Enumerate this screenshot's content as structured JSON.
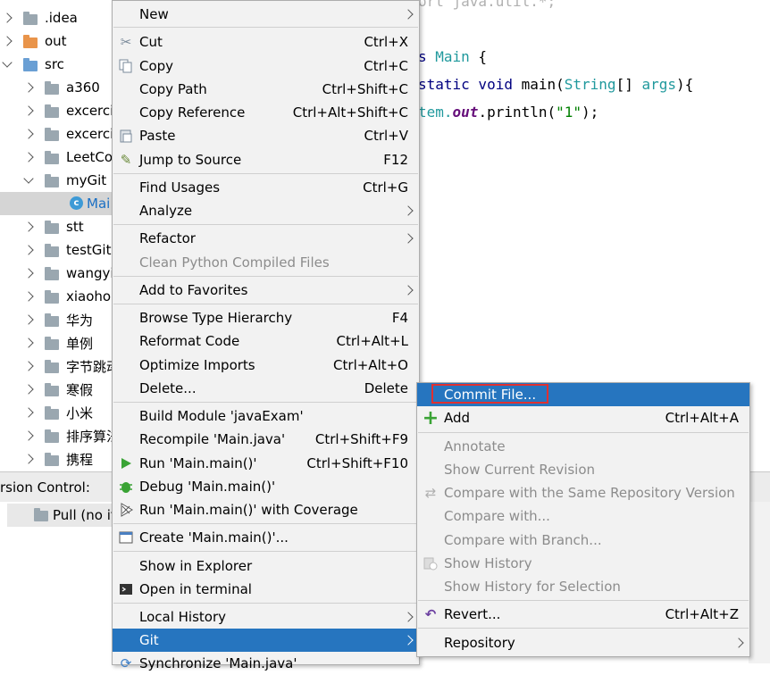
{
  "tree": {
    "items": [
      {
        "label": ".idea",
        "arrow": "right",
        "folder": "gray"
      },
      {
        "label": "out",
        "arrow": "right",
        "folder": "orange"
      },
      {
        "label": "src",
        "arrow": "down",
        "folder": "blue"
      },
      {
        "label": "a360",
        "arrow": "right",
        "folder": "gray"
      },
      {
        "label": "excerci",
        "arrow": "right",
        "folder": "gray"
      },
      {
        "label": "excerci",
        "arrow": "right",
        "folder": "gray"
      },
      {
        "label": "LeetCo",
        "arrow": "right",
        "folder": "gray"
      },
      {
        "label": "myGit",
        "arrow": "down",
        "folder": "gray"
      },
      {
        "label": "Mai",
        "arrow": "none",
        "folder": "class"
      },
      {
        "label": "stt",
        "arrow": "right",
        "folder": "gray"
      },
      {
        "label": "testGit",
        "arrow": "right",
        "folder": "gray"
      },
      {
        "label": "wangyi",
        "arrow": "right",
        "folder": "gray"
      },
      {
        "label": "xiaohou",
        "arrow": "right",
        "folder": "gray"
      },
      {
        "label": "华为",
        "arrow": "right",
        "folder": "gray"
      },
      {
        "label": "单例",
        "arrow": "right",
        "folder": "gray"
      },
      {
        "label": "字节跳动",
        "arrow": "right",
        "folder": "gray"
      },
      {
        "label": "寒假",
        "arrow": "right",
        "folder": "gray"
      },
      {
        "label": "小米",
        "arrow": "right",
        "folder": "gray"
      },
      {
        "label": "排序算法",
        "arrow": "right",
        "folder": "gray"
      },
      {
        "label": "携程",
        "arrow": "right",
        "folder": "gray"
      }
    ]
  },
  "editor": {
    "line1": {
      "kw": "s ",
      "name": "Main",
      "rest": " {"
    },
    "line2": {
      "kw": "static void ",
      "name": "main",
      "open": "(",
      "type": "String",
      "arr": "[] ",
      "param": "args",
      "close": "){"
    },
    "line3": {
      "pre": "tem.",
      "field": "out",
      "mid": ".println(",
      "str": "\"1\"",
      "end": ");"
    }
  },
  "bottom": {
    "vc_label": "rsion Control:",
    "pull_label": "Pull (no it"
  },
  "context_menu": {
    "new": "New",
    "cut": "Cut",
    "cut_sc": "Ctrl+X",
    "copy": "Copy",
    "copy_sc": "Ctrl+C",
    "copy_path": "Copy Path",
    "copy_path_sc": "Ctrl+Shift+C",
    "copy_ref": "Copy Reference",
    "copy_ref_sc": "Ctrl+Alt+Shift+C",
    "paste": "Paste",
    "paste_sc": "Ctrl+V",
    "jump": "Jump to Source",
    "jump_sc": "F12",
    "find": "Find Usages",
    "find_sc": "Ctrl+G",
    "analyze": "Analyze",
    "refactor": "Refactor",
    "clean": "Clean Python Compiled Files",
    "favorites": "Add to Favorites",
    "browse": "Browse Type Hierarchy",
    "browse_sc": "F4",
    "reformat": "Reformat Code",
    "reformat_sc": "Ctrl+Alt+L",
    "optimize": "Optimize Imports",
    "optimize_sc": "Ctrl+Alt+O",
    "delete": "Delete...",
    "delete_sc": "Delete",
    "build": "Build Module 'javaExam'",
    "recompile": "Recompile 'Main.java'",
    "recompile_sc": "Ctrl+Shift+F9",
    "run": "Run 'Main.main()'",
    "run_sc": "Ctrl+Shift+F10",
    "debug": "Debug 'Main.main()'",
    "coverage": "Run 'Main.main()' with Coverage",
    "create": "Create 'Main.main()'...",
    "explorer": "Show in Explorer",
    "terminal": "Open in terminal",
    "history": "Local History",
    "git": "Git",
    "sync": "Synchronize 'Main.java'"
  },
  "git_menu": {
    "commit": "Commit File...",
    "add": "Add",
    "add_sc": "Ctrl+Alt+A",
    "annotate": "Annotate",
    "show_rev": "Show Current Revision",
    "compare_same": "Compare with the Same Repository Version",
    "compare_with": "Compare with...",
    "compare_branch": "Compare with Branch...",
    "show_history": "Show History",
    "history_sel": "Show History for Selection",
    "revert": "Revert...",
    "revert_sc": "Ctrl+Alt+Z",
    "repository": "Repository"
  },
  "colors": {
    "menu_active": "#2675bf",
    "highlight_border": "#e03030",
    "menu_bg": "#f2f2f2"
  }
}
